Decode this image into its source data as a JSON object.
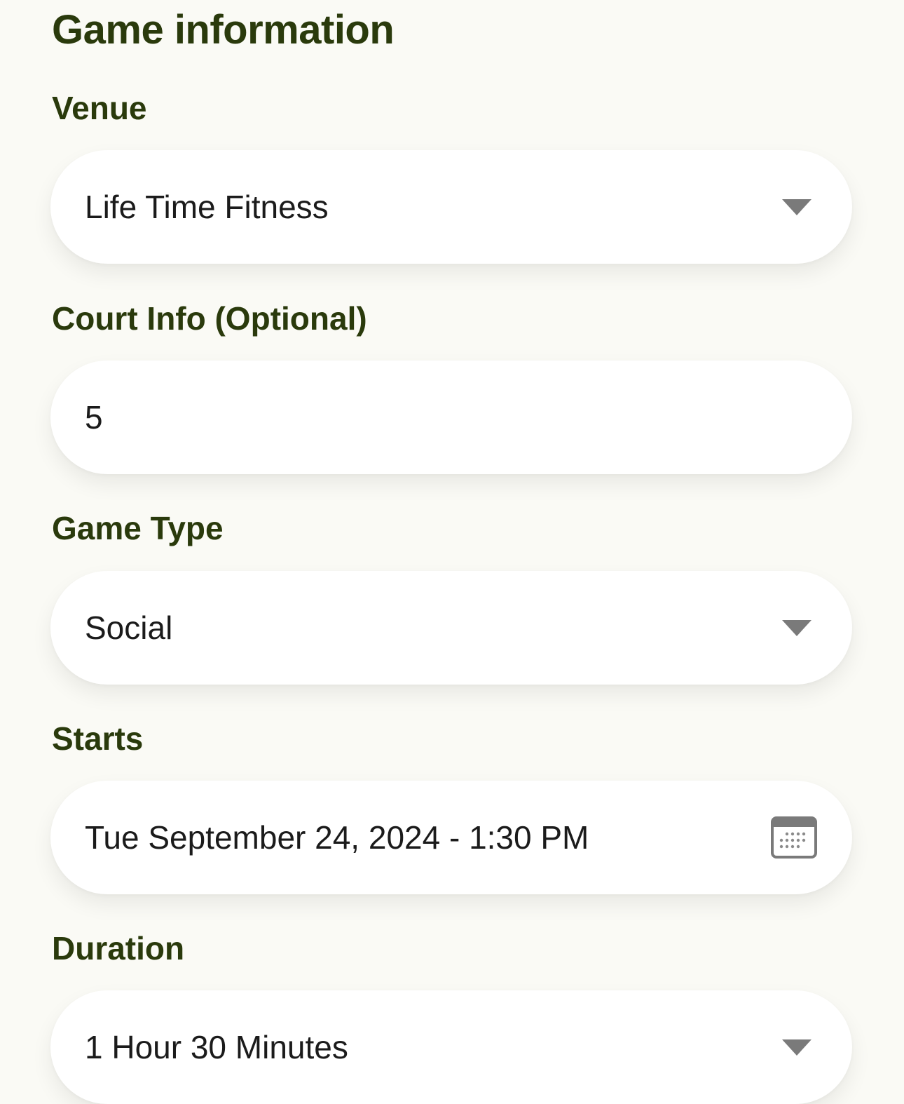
{
  "page": {
    "title": "Game information"
  },
  "form": {
    "venue": {
      "label": "Venue",
      "value": "Life Time Fitness",
      "icon": "chevron-down-icon"
    },
    "court_info": {
      "label": "Court Info (Optional)",
      "value": "5"
    },
    "game_type": {
      "label": "Game Type",
      "value": "Social",
      "icon": "chevron-down-icon"
    },
    "starts": {
      "label": "Starts",
      "value": "Tue September 24, 2024 - 1:30 PM",
      "icon": "calendar-icon"
    },
    "duration": {
      "label": "Duration",
      "value": "1 Hour 30 Minutes",
      "icon": "chevron-down-icon"
    }
  },
  "colors": {
    "background": "#fafaf5",
    "heading": "#2a3a0c",
    "field_background": "#ffffff",
    "icon": "#7a7a7a"
  }
}
